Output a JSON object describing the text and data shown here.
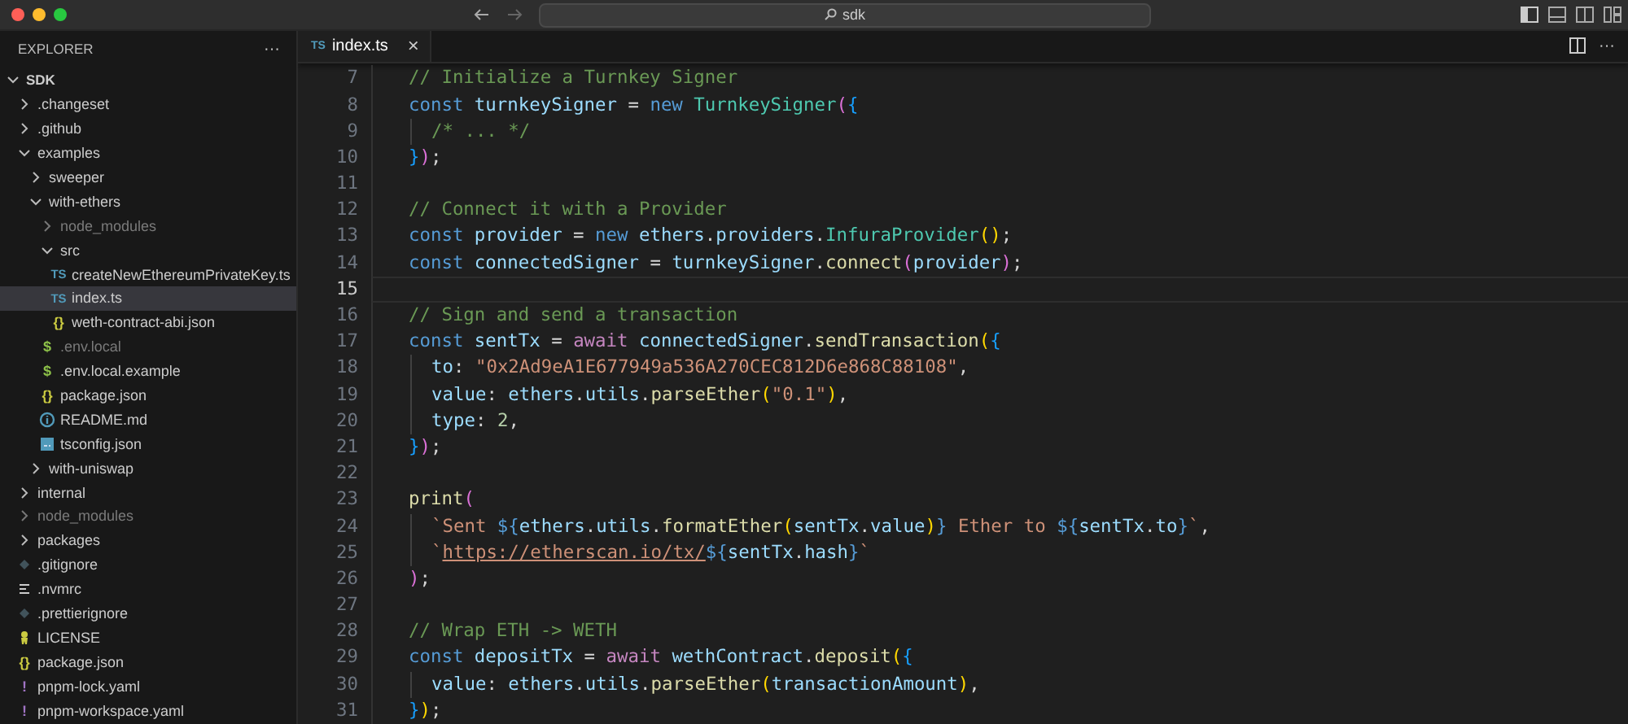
{
  "title_bar": {
    "search": {
      "value": "sdk"
    }
  },
  "sidebar": {
    "title": "EXPLORER",
    "more": "···",
    "workspace": {
      "name": "SDK",
      "expanded": true,
      "children": [
        {
          "kind": "folder",
          "name": ".changeset",
          "expanded": false,
          "ignored": false,
          "selected": false
        },
        {
          "kind": "folder",
          "name": ".github",
          "expanded": false,
          "ignored": false,
          "selected": false
        },
        {
          "kind": "folder",
          "name": "examples",
          "expanded": true,
          "ignored": false,
          "selected": false,
          "children": [
            {
              "kind": "folder",
              "name": "sweeper",
              "expanded": false,
              "ignored": false,
              "selected": false
            },
            {
              "kind": "folder",
              "name": "with-ethers",
              "expanded": true,
              "ignored": false,
              "selected": false,
              "children": [
                {
                  "kind": "folder",
                  "name": "node_modules",
                  "expanded": false,
                  "ignored": true,
                  "selected": false
                },
                {
                  "kind": "folder",
                  "name": "src",
                  "expanded": true,
                  "ignored": false,
                  "selected": false,
                  "children": [
                    {
                      "kind": "ts",
                      "icon_label": "TS",
                      "name": "createNewEthereumPrivateKey.ts",
                      "ignored": false,
                      "selected": false
                    },
                    {
                      "kind": "ts",
                      "icon_label": "TS",
                      "name": "index.ts",
                      "ignored": false,
                      "selected": true
                    },
                    {
                      "kind": "json",
                      "icon_label": "{}",
                      "name": "weth-contract-abi.json",
                      "ignored": false,
                      "selected": false
                    }
                  ]
                },
                {
                  "kind": "env",
                  "icon_label": "$",
                  "name": ".env.local",
                  "ignored": true,
                  "selected": false
                },
                {
                  "kind": "env",
                  "icon_label": "$",
                  "name": ".env.local.example",
                  "ignored": false,
                  "selected": false
                },
                {
                  "kind": "json",
                  "icon_label": "{}",
                  "name": "package.json",
                  "ignored": false,
                  "selected": false
                },
                {
                  "kind": "info",
                  "name": "README.md",
                  "ignored": false,
                  "selected": false
                },
                {
                  "kind": "config",
                  "name": "tsconfig.json",
                  "ignored": false,
                  "selected": false
                }
              ]
            },
            {
              "kind": "folder",
              "name": "with-uniswap",
              "expanded": false,
              "ignored": false,
              "selected": false
            }
          ]
        },
        {
          "kind": "folder",
          "name": "internal",
          "expanded": false,
          "ignored": false,
          "selected": false
        },
        {
          "kind": "folder",
          "name": "node_modules",
          "expanded": false,
          "ignored": true,
          "selected": false
        },
        {
          "kind": "folder",
          "name": "packages",
          "expanded": false,
          "ignored": false,
          "selected": false
        },
        {
          "kind": "ignorefile",
          "name": ".gitignore",
          "ignored": false,
          "selected": false
        },
        {
          "kind": "text",
          "name": ".nvmrc",
          "ignored": false,
          "selected": false
        },
        {
          "kind": "ignorefile",
          "name": ".prettierignore",
          "ignored": false,
          "selected": false
        },
        {
          "kind": "license",
          "name": "LICENSE",
          "ignored": false,
          "selected": false
        },
        {
          "kind": "json",
          "icon_label": "{}",
          "name": "package.json",
          "ignored": false,
          "selected": false
        },
        {
          "kind": "yaml",
          "icon_label": "!",
          "name": "pnpm-lock.yaml",
          "ignored": false,
          "selected": false
        },
        {
          "kind": "yaml",
          "icon_label": "!",
          "name": "pnpm-workspace.yaml",
          "ignored": false,
          "selected": false
        }
      ]
    }
  },
  "tabs": [
    {
      "label": "index.ts",
      "icon_label": "TS",
      "close": "×",
      "selected": true
    }
  ],
  "editor": {
    "lines": [
      {
        "number": "7",
        "current": false,
        "indented": false,
        "tokens": [
          {
            "kind": "comment",
            "text": "// Initialize a Turnkey Signer"
          }
        ]
      },
      {
        "number": "8",
        "current": false,
        "indented": false,
        "tokens": [
          {
            "kind": "keyword",
            "text": "const "
          },
          {
            "kind": "variable",
            "text": "turnkeySigner"
          },
          {
            "kind": "plain",
            "text": " = "
          },
          {
            "kind": "keyword",
            "text": "new "
          },
          {
            "kind": "class",
            "text": "TurnkeySigner"
          },
          {
            "kind": "bracket2",
            "text": "("
          },
          {
            "kind": "bracket3",
            "text": "{"
          }
        ]
      },
      {
        "number": "9",
        "current": false,
        "indented": true,
        "tokens": [
          {
            "kind": "comment",
            "text": "/* ... */"
          }
        ]
      },
      {
        "number": "10",
        "current": false,
        "indented": false,
        "tokens": [
          {
            "kind": "bracket3",
            "text": "}"
          },
          {
            "kind": "bracket2",
            "text": ")"
          },
          {
            "kind": "plain",
            "text": ";"
          }
        ]
      },
      {
        "number": "11",
        "current": false
      },
      {
        "number": "12",
        "current": false,
        "indented": false,
        "tokens": [
          {
            "kind": "comment",
            "text": "// Connect it with a Provider"
          }
        ]
      },
      {
        "number": "13",
        "current": false,
        "indented": false,
        "tokens": [
          {
            "kind": "keyword",
            "text": "const "
          },
          {
            "kind": "variable",
            "text": "provider"
          },
          {
            "kind": "plain",
            "text": " = "
          },
          {
            "kind": "keyword",
            "text": "new "
          },
          {
            "kind": "variable",
            "text": "ethers"
          },
          {
            "kind": "plain",
            "text": "."
          },
          {
            "kind": "variable",
            "text": "providers"
          },
          {
            "kind": "plain",
            "text": "."
          },
          {
            "kind": "class",
            "text": "InfuraProvider"
          },
          {
            "kind": "bracket1",
            "text": "()"
          },
          {
            "kind": "plain",
            "text": ";"
          }
        ]
      },
      {
        "number": "14",
        "current": false,
        "indented": false,
        "tokens": [
          {
            "kind": "keyword",
            "text": "const "
          },
          {
            "kind": "variable",
            "text": "connectedSigner"
          },
          {
            "kind": "plain",
            "text": " = "
          },
          {
            "kind": "variable",
            "text": "turnkeySigner"
          },
          {
            "kind": "plain",
            "text": "."
          },
          {
            "kind": "function",
            "text": "connect"
          },
          {
            "kind": "bracket2",
            "text": "("
          },
          {
            "kind": "variable",
            "text": "provider"
          },
          {
            "kind": "bracket2",
            "text": ")"
          },
          {
            "kind": "plain",
            "text": ";"
          }
        ]
      },
      {
        "number": "15",
        "current": true
      },
      {
        "number": "16",
        "current": false,
        "indented": false,
        "tokens": [
          {
            "kind": "comment",
            "text": "// Sign and send a transaction"
          }
        ]
      },
      {
        "number": "17",
        "current": false,
        "indented": false,
        "tokens": [
          {
            "kind": "keyword",
            "text": "const "
          },
          {
            "kind": "variable",
            "text": "sentTx"
          },
          {
            "kind": "plain",
            "text": " = "
          },
          {
            "kind": "control",
            "text": "await "
          },
          {
            "kind": "variable",
            "text": "connectedSigner"
          },
          {
            "kind": "plain",
            "text": "."
          },
          {
            "kind": "function",
            "text": "sendTransaction"
          },
          {
            "kind": "bracket1",
            "text": "("
          },
          {
            "kind": "bracket3",
            "text": "{"
          }
        ]
      },
      {
        "number": "18",
        "current": false,
        "indented": true,
        "tokens": [
          {
            "kind": "variable",
            "text": "to"
          },
          {
            "kind": "plain",
            "text": ": "
          },
          {
            "kind": "string",
            "text": "\"0x2Ad9eA1E677949a536A270CEC812D6e868C88108\""
          },
          {
            "kind": "plain",
            "text": ","
          }
        ]
      },
      {
        "number": "19",
        "current": false,
        "indented": true,
        "tokens": [
          {
            "kind": "variable",
            "text": "value"
          },
          {
            "kind": "plain",
            "text": ": "
          },
          {
            "kind": "variable",
            "text": "ethers"
          },
          {
            "kind": "plain",
            "text": "."
          },
          {
            "kind": "variable",
            "text": "utils"
          },
          {
            "kind": "plain",
            "text": "."
          },
          {
            "kind": "function",
            "text": "parseEther"
          },
          {
            "kind": "bracket1",
            "text": "("
          },
          {
            "kind": "string",
            "text": "\"0.1\""
          },
          {
            "kind": "bracket1",
            "text": ")"
          },
          {
            "kind": "plain",
            "text": ","
          }
        ]
      },
      {
        "number": "20",
        "current": false,
        "indented": true,
        "tokens": [
          {
            "kind": "variable",
            "text": "type"
          },
          {
            "kind": "plain",
            "text": ": "
          },
          {
            "kind": "number",
            "text": "2"
          },
          {
            "kind": "plain",
            "text": ","
          }
        ]
      },
      {
        "number": "21",
        "current": false,
        "indented": false,
        "tokens": [
          {
            "kind": "bracket3",
            "text": "}"
          },
          {
            "kind": "bracket2",
            "text": ")"
          },
          {
            "kind": "plain",
            "text": ";"
          }
        ]
      },
      {
        "number": "22",
        "current": false
      },
      {
        "number": "23",
        "current": false,
        "indented": false,
        "tokens": [
          {
            "kind": "function",
            "text": "print"
          },
          {
            "kind": "bracket2",
            "text": "("
          }
        ]
      },
      {
        "number": "24",
        "current": false,
        "indented": true,
        "tokens": [
          {
            "kind": "string",
            "text": "`Sent "
          },
          {
            "kind": "keyword",
            "text": "${"
          },
          {
            "kind": "variable",
            "text": "ethers"
          },
          {
            "kind": "plain",
            "text": "."
          },
          {
            "kind": "variable",
            "text": "utils"
          },
          {
            "kind": "plain",
            "text": "."
          },
          {
            "kind": "function",
            "text": "formatEther"
          },
          {
            "kind": "bracket1",
            "text": "("
          },
          {
            "kind": "variable",
            "text": "sentTx"
          },
          {
            "kind": "plain",
            "text": "."
          },
          {
            "kind": "variable",
            "text": "value"
          },
          {
            "kind": "bracket1",
            "text": ")"
          },
          {
            "kind": "keyword",
            "text": "}"
          },
          {
            "kind": "string",
            "text": " Ether to "
          },
          {
            "kind": "keyword",
            "text": "${"
          },
          {
            "kind": "variable",
            "text": "sentTx"
          },
          {
            "kind": "plain",
            "text": "."
          },
          {
            "kind": "variable",
            "text": "to"
          },
          {
            "kind": "keyword",
            "text": "}"
          },
          {
            "kind": "string",
            "text": "`"
          },
          {
            "kind": "plain",
            "text": ","
          }
        ]
      },
      {
        "number": "25",
        "current": false,
        "indented": true,
        "tokens": [
          {
            "kind": "string",
            "text": "`"
          },
          {
            "kind": "link",
            "text": "https://etherscan.io/tx/"
          },
          {
            "kind": "keyword",
            "text": "${"
          },
          {
            "kind": "variable",
            "text": "sentTx"
          },
          {
            "kind": "plain",
            "text": "."
          },
          {
            "kind": "variable",
            "text": "hash"
          },
          {
            "kind": "keyword",
            "text": "}"
          },
          {
            "kind": "string",
            "text": "`"
          }
        ]
      },
      {
        "number": "26",
        "current": false,
        "indented": false,
        "tokens": [
          {
            "kind": "bracket2",
            "text": ")"
          },
          {
            "kind": "plain",
            "text": ";"
          }
        ]
      },
      {
        "number": "27",
        "current": false
      },
      {
        "number": "28",
        "current": false,
        "indented": false,
        "tokens": [
          {
            "kind": "comment",
            "text": "// Wrap ETH -> WETH"
          }
        ]
      },
      {
        "number": "29",
        "current": false,
        "indented": false,
        "tokens": [
          {
            "kind": "keyword",
            "text": "const "
          },
          {
            "kind": "variable",
            "text": "depositTx"
          },
          {
            "kind": "plain",
            "text": " = "
          },
          {
            "kind": "control",
            "text": "await "
          },
          {
            "kind": "variable",
            "text": "wethContract"
          },
          {
            "kind": "plain",
            "text": "."
          },
          {
            "kind": "function",
            "text": "deposit"
          },
          {
            "kind": "bracket1",
            "text": "("
          },
          {
            "kind": "bracket3",
            "text": "{"
          }
        ]
      },
      {
        "number": "30",
        "current": false,
        "indented": true,
        "tokens": [
          {
            "kind": "variable",
            "text": "value"
          },
          {
            "kind": "plain",
            "text": ": "
          },
          {
            "kind": "variable",
            "text": "ethers"
          },
          {
            "kind": "plain",
            "text": "."
          },
          {
            "kind": "variable",
            "text": "utils"
          },
          {
            "kind": "plain",
            "text": "."
          },
          {
            "kind": "function",
            "text": "parseEther"
          },
          {
            "kind": "bracket1",
            "text": "("
          },
          {
            "kind": "variable",
            "text": "transactionAmount"
          },
          {
            "kind": "bracket1",
            "text": ")"
          },
          {
            "kind": "plain",
            "text": ","
          }
        ]
      },
      {
        "number": "31",
        "current": false,
        "indented": false,
        "tokens": [
          {
            "kind": "bracket3",
            "text": "}"
          },
          {
            "kind": "bracket1",
            "text": ")"
          },
          {
            "kind": "plain",
            "text": ";"
          }
        ]
      }
    ]
  }
}
